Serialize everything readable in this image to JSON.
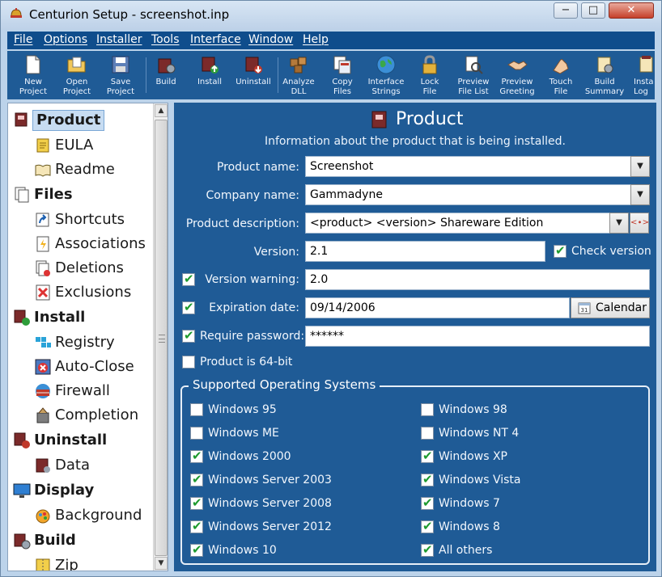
{
  "window": {
    "title": "Centurion Setup - screenshot.inp",
    "min_glyph": "−",
    "max_glyph": "□",
    "close_glyph": "✕"
  },
  "menu": {
    "items": [
      "File",
      "Options",
      "Installer",
      "Tools",
      "Interface",
      "Window",
      "Help"
    ]
  },
  "toolbar": {
    "buttons": [
      {
        "label": "New\nProject",
        "icon": "new-file-icon"
      },
      {
        "label": "Open\nProject",
        "icon": "open-folder-icon"
      },
      {
        "label": "Save\nProject",
        "icon": "save-icon"
      },
      {
        "label": "Build",
        "icon": "build-icon"
      },
      {
        "label": "Install",
        "icon": "install-icon"
      },
      {
        "label": "Uninstall",
        "icon": "uninstall-icon"
      },
      {
        "label": "Analyze\nDLL",
        "icon": "analyze-dll-icon"
      },
      {
        "label": "Copy\nFiles",
        "icon": "copy-files-icon"
      },
      {
        "label": "Interface\nStrings",
        "icon": "globe-icon"
      },
      {
        "label": "Lock\nFile",
        "icon": "lock-icon"
      },
      {
        "label": "Preview\nFile List",
        "icon": "preview-file-list-icon"
      },
      {
        "label": "Preview\nGreeting",
        "icon": "handshake-icon"
      },
      {
        "label": "Touch\nFile",
        "icon": "touch-hand-icon"
      },
      {
        "label": "Build\nSummary",
        "icon": "build-summary-icon"
      },
      {
        "label": "Insta\nLog",
        "icon": "install-log-icon"
      }
    ]
  },
  "tree": {
    "items": [
      {
        "label": "Product",
        "level": 0,
        "selected": true,
        "icon": "product-box-icon"
      },
      {
        "label": "EULA",
        "level": 1,
        "icon": "scroll-icon"
      },
      {
        "label": "Readme",
        "level": 1,
        "icon": "book-icon"
      },
      {
        "label": "Files",
        "level": 0,
        "icon": "files-icon"
      },
      {
        "label": "Shortcuts",
        "level": 1,
        "icon": "shortcut-icon"
      },
      {
        "label": "Associations",
        "level": 1,
        "icon": "association-icon"
      },
      {
        "label": "Deletions",
        "level": 1,
        "icon": "deletions-icon"
      },
      {
        "label": "Exclusions",
        "level": 1,
        "icon": "exclusions-icon"
      },
      {
        "label": "Install",
        "level": 0,
        "icon": "install-icon"
      },
      {
        "label": "Registry",
        "level": 1,
        "icon": "registry-icon"
      },
      {
        "label": "Auto-Close",
        "level": 1,
        "icon": "auto-close-icon"
      },
      {
        "label": "Firewall",
        "level": 1,
        "icon": "firewall-icon"
      },
      {
        "label": "Completion",
        "level": 1,
        "icon": "completion-icon"
      },
      {
        "label": "Uninstall",
        "level": 0,
        "icon": "uninstall-icon"
      },
      {
        "label": "Data",
        "level": 1,
        "icon": "data-icon"
      },
      {
        "label": "Display",
        "level": 0,
        "icon": "monitor-icon"
      },
      {
        "label": "Background",
        "level": 1,
        "icon": "background-icon"
      },
      {
        "label": "Build",
        "level": 0,
        "icon": "build-icon"
      },
      {
        "label": "Zip",
        "level": 1,
        "icon": "zip-icon"
      }
    ]
  },
  "panel": {
    "title": "Product",
    "subtitle": "Information about the product that is being installed.",
    "product_name_label": "Product name:",
    "product_name_value": "Screenshot",
    "company_name_label": "Company name:",
    "company_name_value": "Gammadyne",
    "product_description_label": "Product description:",
    "product_description_value": "<product> <version> Shareware Edition",
    "macro_button_text": "<∙>",
    "version_label": "Version:",
    "version_value": "2.1",
    "check_version_label": "Check version",
    "check_version_checked": true,
    "version_warning_label": "Version warning:",
    "version_warning_checked": true,
    "version_warning_value": "2.0",
    "expiration_date_label": "Expiration date:",
    "expiration_date_checked": true,
    "expiration_date_value": "09/14/2006",
    "calendar_label": "Calendar",
    "calendar_icon_text": "31",
    "require_password_label": "Require password:",
    "require_password_checked": true,
    "require_password_value": "******",
    "product_64bit_label": "Product is 64-bit",
    "product_64bit_checked": false,
    "os_group_title": "Supported Operating Systems",
    "os": [
      {
        "label": "Windows 95",
        "checked": false
      },
      {
        "label": "Windows 98",
        "checked": false
      },
      {
        "label": "Windows ME",
        "checked": false
      },
      {
        "label": "Windows NT 4",
        "checked": false
      },
      {
        "label": "Windows 2000",
        "checked": true
      },
      {
        "label": "Windows XP",
        "checked": true
      },
      {
        "label": "Windows Server 2003",
        "checked": true
      },
      {
        "label": "Windows Vista",
        "checked": true
      },
      {
        "label": "Windows Server 2008",
        "checked": true
      },
      {
        "label": "Windows 7",
        "checked": true
      },
      {
        "label": "Windows Server 2012",
        "checked": true
      },
      {
        "label": "Windows 8",
        "checked": true
      },
      {
        "label": "Windows 10",
        "checked": true
      },
      {
        "label": "All others",
        "checked": true
      }
    ]
  },
  "colors": {
    "panel_bg": "#1f5b96",
    "menu_bg": "#0f4d8c",
    "check_green": "#1e9a2e",
    "selected_bg": "#c7dcf2"
  }
}
